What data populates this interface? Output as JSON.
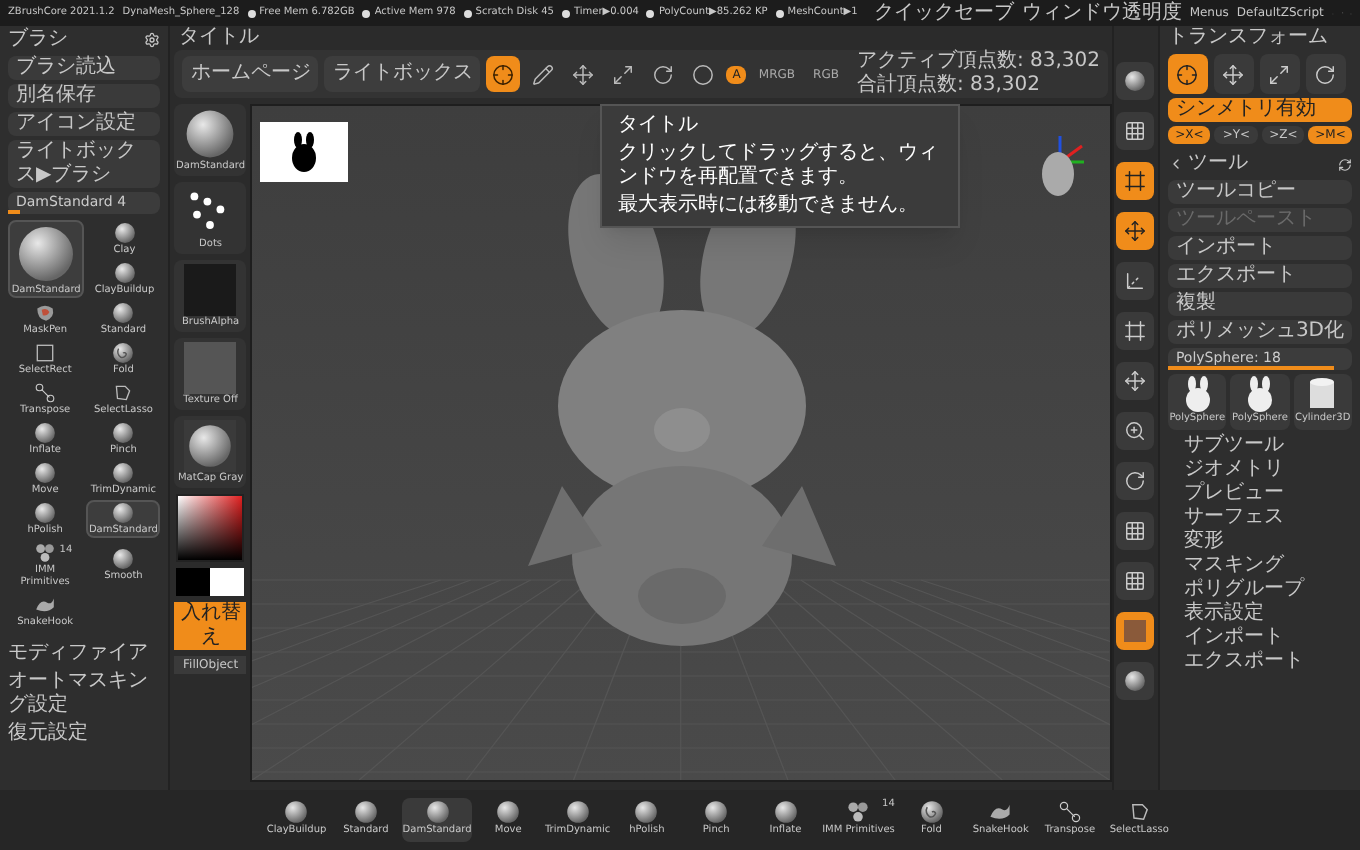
{
  "title_bar": {
    "app": "ZBrushCore 2021.1.2",
    "file": "DynaMesh_Sphere_128",
    "stats": [
      "Free Mem 6.782GB",
      "Active Mem 978",
      "Scratch Disk 45",
      "Timer▶0.004",
      "PolyCount▶85.262 KP",
      "MeshCount▶1"
    ],
    "right": [
      "クイックセーブ",
      "ウィンドウ透明度",
      "Menus",
      "DefaultZScript"
    ]
  },
  "brush_palette": {
    "title": "ブラシ",
    "buttons": [
      "ブラシ読込",
      "別名保存",
      "アイコン設定",
      "ライトボックス▶ブラシ"
    ],
    "slider": {
      "label": "DamStandard  4",
      "level": 0.08
    },
    "current_brush": {
      "name": "DamStandard"
    },
    "brushes": [
      {
        "name": "Clay",
        "kind": "sphere",
        "selected": false
      },
      {
        "name": "ClayBuildup",
        "kind": "sphere",
        "selected": false
      },
      {
        "name": "MaskPen",
        "kind": "mask",
        "selected": false
      },
      {
        "name": "Standard",
        "kind": "sphere",
        "selected": false
      },
      {
        "name": "SelectRect",
        "kind": "rect",
        "selected": false
      },
      {
        "name": "Fold",
        "kind": "spiral",
        "selected": false
      },
      {
        "name": "Transpose",
        "kind": "transpose",
        "selected": false
      },
      {
        "name": "SelectLasso",
        "kind": "lasso",
        "selected": false
      },
      {
        "name": "Inflate",
        "kind": "sphere",
        "selected": false
      },
      {
        "name": "Pinch",
        "kind": "sphere",
        "selected": false
      },
      {
        "name": "Move",
        "kind": "sphere",
        "selected": false
      },
      {
        "name": "TrimDynamic",
        "kind": "sphere",
        "selected": false
      },
      {
        "name": "hPolish",
        "kind": "sphere",
        "selected": false
      },
      {
        "name": "DamStandard",
        "kind": "sphere",
        "selected": true
      },
      {
        "name": "IMM Primitives",
        "kind": "imm",
        "count": "14",
        "selected": false
      },
      {
        "name": "Smooth",
        "kind": "sphere",
        "selected": false
      },
      {
        "name": "SnakeHook",
        "kind": "snake",
        "selected": false
      }
    ],
    "menu": [
      "モディファイア",
      "オートマスキング設定",
      "復元設定"
    ]
  },
  "top_bar": {
    "title": "タイトル",
    "buttons": [
      "ホームページ",
      "ライトボックス"
    ],
    "tools": [
      {
        "kind": "gizmo",
        "selected": true
      },
      {
        "kind": "draw",
        "selected": false
      },
      {
        "kind": "move",
        "selected": false
      },
      {
        "kind": "scale",
        "selected": false
      },
      {
        "kind": "rotate",
        "selected": false
      },
      {
        "kind": "material",
        "selected": false
      }
    ],
    "color_modes": [
      {
        "label": "A",
        "selected": true
      },
      {
        "label": "MRGB",
        "selected": false
      },
      {
        "label": "RGB",
        "selected": false
      }
    ],
    "vertex_info": [
      "アクティブ頂点数: 83,302",
      "合計頂点数: 83,302"
    ]
  },
  "tooltip": {
    "title": "タイトル",
    "lines": [
      "クリックしてドラッグすると、ウィンドウを再配置できます。",
      "最大表示時には移動できません。"
    ]
  },
  "brush_column": [
    {
      "kind": "sphere",
      "label": "DamStandard"
    },
    {
      "kind": "dots",
      "label": "Dots"
    },
    {
      "kind": "alpha",
      "label": "BrushAlpha"
    },
    {
      "kind": "texture",
      "label": "Texture Off"
    },
    {
      "kind": "matcap",
      "label": "MatCap Gray"
    }
  ],
  "swap_button": "入れ替え",
  "fill_button": "FillObject",
  "view_controls": [
    {
      "kind": "sphere",
      "selected": false
    },
    {
      "kind": "grid",
      "selected": false
    },
    {
      "kind": "frame",
      "selected": true
    },
    {
      "kind": "move",
      "selected": true
    },
    {
      "kind": "xyz",
      "selected": false
    },
    {
      "kind": "frame",
      "selected": false
    },
    {
      "kind": "move",
      "selected": false
    },
    {
      "kind": "zoom",
      "selected": false
    },
    {
      "kind": "rotate",
      "selected": false
    },
    {
      "kind": "grid",
      "selected": false
    },
    {
      "kind": "polyf",
      "selected": false
    },
    {
      "kind": "texture",
      "selected": true
    },
    {
      "kind": "sphere",
      "selected": false
    }
  ],
  "transform": {
    "title": "トランスフォーム",
    "tools": [
      {
        "kind": "gizmo",
        "selected": true
      },
      {
        "kind": "move",
        "selected": false
      },
      {
        "kind": "scale",
        "selected": false
      },
      {
        "kind": "rotate",
        "selected": false
      }
    ],
    "symmetry": {
      "label": "シンメトリ有効",
      "on": true
    },
    "axes": [
      {
        "label": ">X<",
        "selected": true
      },
      {
        "label": ">Y<",
        "selected": false
      },
      {
        "label": ">Z<",
        "selected": false
      },
      {
        "label": ">M<",
        "selected": true
      }
    ]
  },
  "tool_palette": {
    "title": "ツール",
    "buttons": [
      {
        "label": "ツールコピー",
        "disabled": false
      },
      {
        "label": "ツールペースト",
        "disabled": true
      },
      {
        "label": "インポート",
        "disabled": false
      },
      {
        "label": "エクスポート",
        "disabled": false
      },
      {
        "label": "複製",
        "disabled": false
      },
      {
        "label": "ポリメッシュ3D化",
        "disabled": false
      }
    ],
    "slider": {
      "label": "PolySphere: 18",
      "level": 0.9
    },
    "thumbnails": [
      {
        "label": "PolySphere",
        "kind": "figure"
      },
      {
        "label": "PolySphere",
        "kind": "figure"
      },
      {
        "label": "Cylinder3D",
        "kind": "cylinder"
      }
    ],
    "menu": [
      "サブツール",
      "ジオメトリ",
      "プレビュー",
      "サーフェス",
      "変形",
      "マスキング",
      "ポリグループ",
      "表示設定",
      "インポート",
      "エクスポート"
    ]
  },
  "bottom_shelf": [
    {
      "label": "ClayBuildup",
      "kind": "sphere",
      "selected": false
    },
    {
      "label": "Standard",
      "kind": "sphere",
      "selected": false
    },
    {
      "label": "DamStandard",
      "kind": "sphere",
      "selected": true
    },
    {
      "label": "Move",
      "kind": "sphere",
      "selected": false
    },
    {
      "label": "TrimDynamic",
      "kind": "sphere",
      "selected": false
    },
    {
      "label": "hPolish",
      "kind": "sphere",
      "selected": false
    },
    {
      "label": "Pinch",
      "kind": "sphere",
      "selected": false
    },
    {
      "label": "Inflate",
      "kind": "sphere",
      "selected": false
    },
    {
      "label": "IMM Primitives",
      "kind": "imm",
      "count": "14",
      "selected": false
    },
    {
      "label": "Fold",
      "kind": "spiral",
      "selected": false
    },
    {
      "label": "SnakeHook",
      "kind": "snake",
      "selected": false
    },
    {
      "label": "Transpose",
      "kind": "transpose",
      "selected": false
    },
    {
      "label": "SelectLasso",
      "kind": "lasso",
      "selected": false
    }
  ]
}
